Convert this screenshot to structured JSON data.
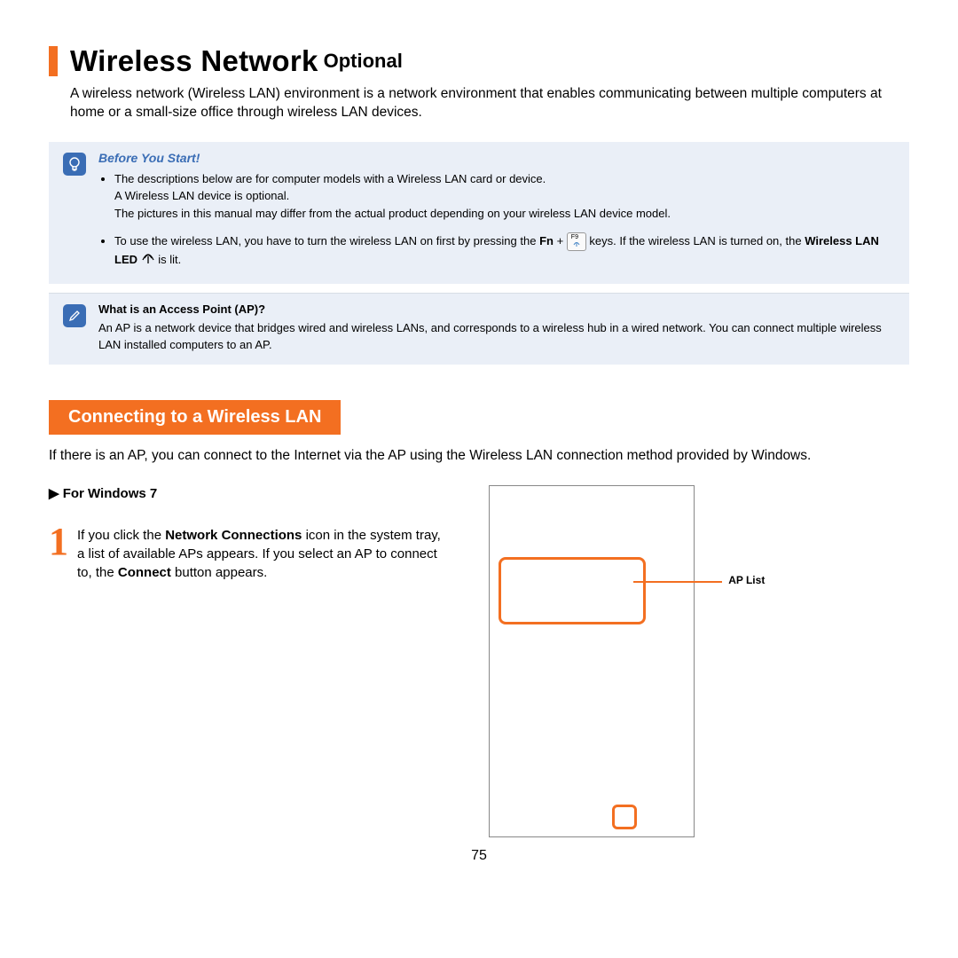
{
  "title": {
    "main": "Wireless Network",
    "sub": "Optional"
  },
  "intro": "A wireless network (Wireless LAN) environment is a network environment that enables communicating between multiple computers at home or a small-size office through wireless LAN devices.",
  "before": {
    "heading": "Before You Start!",
    "b1_line1": "The descriptions below are for computer models with a Wireless LAN card or device.",
    "b1_line2": "A Wireless LAN device is optional.",
    "b1_line3": "The pictures in this manual may differ from the actual product depending on your wireless LAN device model.",
    "b2_pre": "To use the wireless LAN, you have to turn the wireless LAN on first by pressing the ",
    "b2_fn": "Fn",
    "b2_plus": " + ",
    "b2_key": "F9",
    "b2_post": " keys. If the wireless LAN is turned on, the ",
    "b2_bold": "Wireless LAN LED",
    "b2_end": " is lit."
  },
  "ap": {
    "heading": "What is an Access Point (AP)?",
    "body": "An AP is a network device that bridges wired and wireless LANs, and corresponds to a wireless hub in a wired network. You can connect multiple wireless LAN installed computers to an AP."
  },
  "section": {
    "heading": "Connecting to a Wireless LAN",
    "body": "If there is an AP, you can connect to the Internet via the AP using the Wireless LAN connection method provided by Windows."
  },
  "forwin": "▶  For Windows 7",
  "step1": {
    "num": "1",
    "pre": "If you click the ",
    "b1": "Network Connections",
    "mid": "     icon in the system tray, a list of available APs appears. If you select an AP to connect to, the ",
    "b2": "Connect",
    "post": " button appears."
  },
  "aplist": "AP List",
  "pageNum": "75"
}
